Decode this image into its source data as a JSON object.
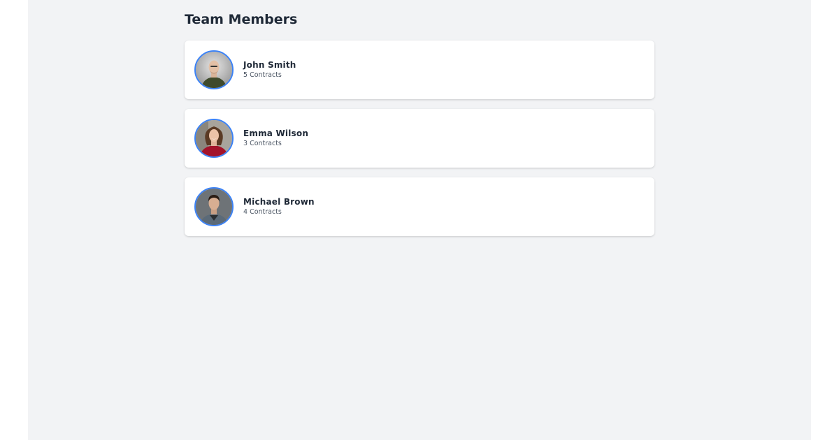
{
  "page": {
    "title": "Team Members"
  },
  "members": [
    {
      "name": "John Smith",
      "contracts": "5 Contracts",
      "avatar": "bald-man-photo"
    },
    {
      "name": "Emma Wilson",
      "contracts": "3 Contracts",
      "avatar": "woman-red-sweater-photo"
    },
    {
      "name": "Michael Brown",
      "contracts": "4 Contracts",
      "avatar": "man-dark-hair-photo"
    }
  ],
  "colors": {
    "background": "#f2f3f5",
    "card": "#ffffff",
    "avatar_ring": "#3b82f6",
    "text_primary": "#1f2937",
    "text_secondary": "#4b5563"
  }
}
